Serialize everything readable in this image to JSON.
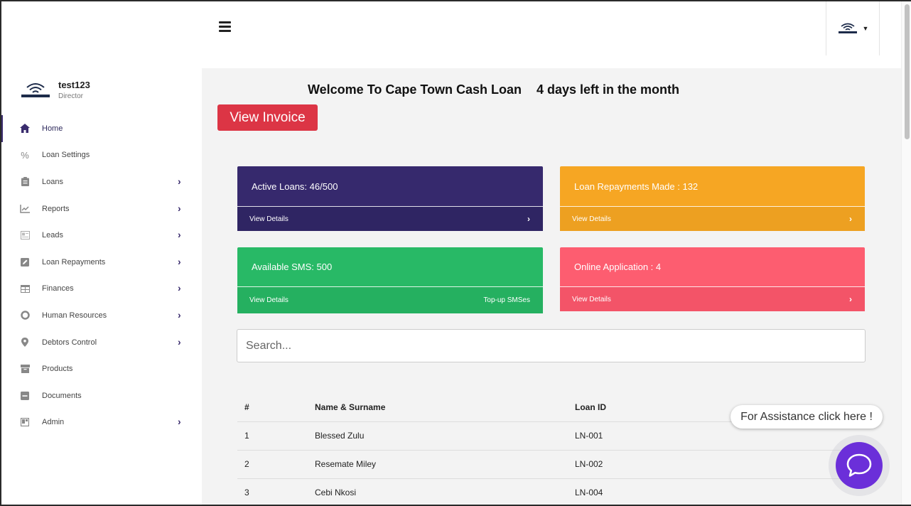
{
  "header": {
    "menu_icon": "hamburger-icon",
    "user_logo_icon": "wifi-logo-icon",
    "user_menu_chevron": "chevron-down-icon"
  },
  "sidebar": {
    "profile": {
      "name": "test123",
      "role": "Director"
    },
    "items": [
      {
        "label": "Home",
        "icon": "home-icon",
        "active": true,
        "has_submenu": false
      },
      {
        "label": "Loan Settings",
        "icon": "percent-icon",
        "active": false,
        "has_submenu": false
      },
      {
        "label": "Loans",
        "icon": "clipboard-icon",
        "active": false,
        "has_submenu": true
      },
      {
        "label": "Reports",
        "icon": "chart-icon",
        "active": false,
        "has_submenu": true
      },
      {
        "label": "Leads",
        "icon": "lead-card-icon",
        "active": false,
        "has_submenu": true
      },
      {
        "label": "Loan Repayments",
        "icon": "edit-icon",
        "active": false,
        "has_submenu": true
      },
      {
        "label": "Finances",
        "icon": "table-icon",
        "active": false,
        "has_submenu": true
      },
      {
        "label": "Human Resources",
        "icon": "circle-icon",
        "active": false,
        "has_submenu": true
      },
      {
        "label": "Debtors Control",
        "icon": "location-pin-icon",
        "active": false,
        "has_submenu": true
      },
      {
        "label": "Products",
        "icon": "box-icon",
        "active": false,
        "has_submenu": false
      },
      {
        "label": "Documents",
        "icon": "minus-square-icon",
        "active": false,
        "has_submenu": false
      },
      {
        "label": "Admin",
        "icon": "admin-panel-icon",
        "active": false,
        "has_submenu": true
      }
    ]
  },
  "main": {
    "welcome": "Welcome To Cape Town Cash Loan",
    "days_left": "4 days left in the month",
    "invoice_button": "View Invoice",
    "cards": {
      "active_loans": {
        "title": "Active Loans: 46/500",
        "link": "View Details",
        "color": "#36296d"
      },
      "repayments": {
        "title": "Loan Repayments Made : 132",
        "link": "View Details",
        "color": "#f6a623"
      },
      "sms": {
        "title": "Available SMS: 500",
        "link": "View Details",
        "extra": "Top-up SMSes",
        "color": "#28b966"
      },
      "online": {
        "title": "Online Application : 4",
        "link": "View Details",
        "color": "#fd5d70"
      }
    },
    "search": {
      "placeholder": "Search...",
      "value": ""
    },
    "table": {
      "headers": [
        "#",
        "Name & Surname",
        "Loan ID"
      ],
      "rows": [
        [
          "1",
          "Blessed Zulu",
          "LN-001"
        ],
        [
          "2",
          "Resemate Miley",
          "LN-002"
        ],
        [
          "3",
          "Cebi Nkosi",
          "LN-004"
        ]
      ]
    }
  },
  "assistance": {
    "label": "For Assistance click here !",
    "chat_icon": "chat-bubble-icon"
  },
  "colors": {
    "accent": "#3a2c6e",
    "danger": "#dc3545",
    "chat": "#6b2fd9"
  }
}
